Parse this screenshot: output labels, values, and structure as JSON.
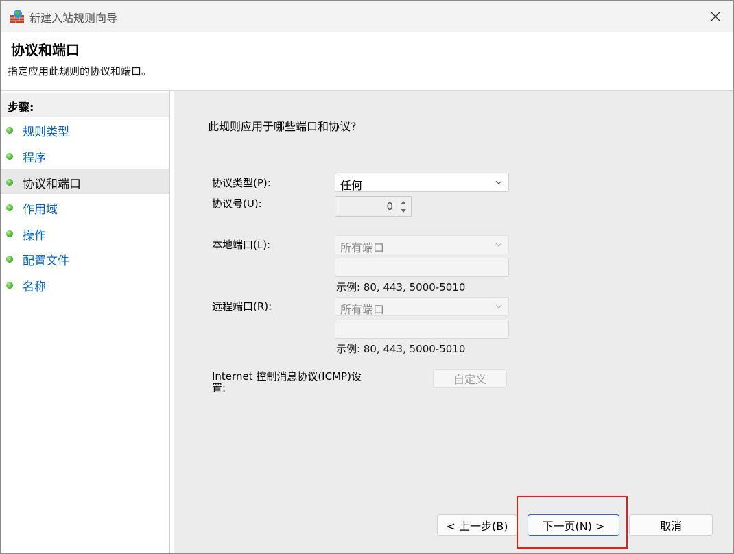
{
  "window": {
    "title": "新建入站规则向导"
  },
  "header": {
    "title": "协议和端口",
    "subtitle": "指定应用此规则的协议和端口。"
  },
  "steps": {
    "heading": "步骤:",
    "items": [
      {
        "label": "规则类型"
      },
      {
        "label": "程序"
      },
      {
        "label": "协议和端口"
      },
      {
        "label": "作用域"
      },
      {
        "label": "操作"
      },
      {
        "label": "配置文件"
      },
      {
        "label": "名称"
      }
    ],
    "active_index": 2
  },
  "form": {
    "question": "此规则应用于哪些端口和协议?",
    "protocol_type": {
      "label": "协议类型(P):",
      "value": "任何"
    },
    "protocol_number": {
      "label": "协议号(U):",
      "value": "0"
    },
    "local_port": {
      "label": "本地端口(L):",
      "value": "所有端口",
      "example": "示例: 80, 443, 5000-5010"
    },
    "remote_port": {
      "label": "远程端口(R):",
      "value": "所有端口",
      "example": "示例: 80, 443, 5000-5010"
    },
    "icmp": {
      "label_line1": "Internet 控制消息协议(ICMP)设",
      "label_line2": "置:",
      "button": "自定义"
    }
  },
  "buttons": {
    "back": "< 上一步(B)",
    "next": "下一页(N) >",
    "cancel": "取消"
  },
  "colors": {
    "link": "#0a63b8",
    "highlight": "#e02020",
    "dot": "#4fb63a"
  }
}
